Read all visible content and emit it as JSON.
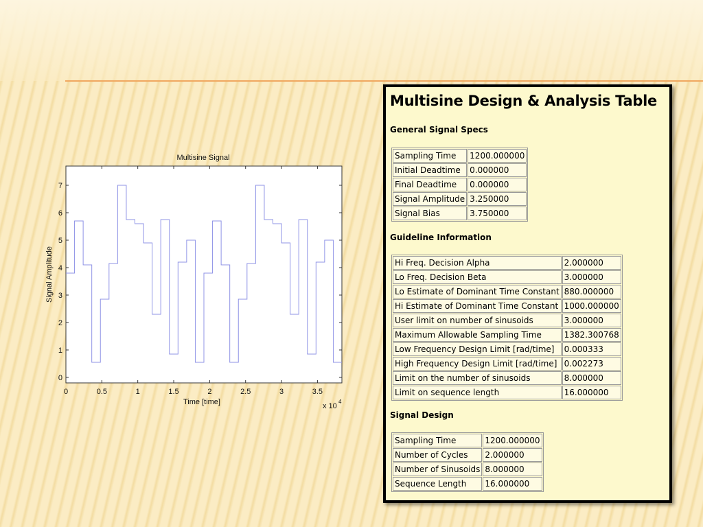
{
  "chart_data": {
    "type": "line",
    "title": "Multisine Signal",
    "xlabel": "Time [time]",
    "ylabel": "Signal Amplitude",
    "x_multiplier_label": "x 10",
    "x_multiplier_exp": "4",
    "xlim": [
      0,
      3.84
    ],
    "ylim": [
      -0.2,
      7.7
    ],
    "x_ticks": [
      "0",
      "0.5",
      "1",
      "1.5",
      "2",
      "2.5",
      "3",
      "3.5"
    ],
    "y_ticks": [
      "0",
      "1",
      "2",
      "3",
      "4",
      "5",
      "6",
      "7"
    ],
    "grid": false,
    "series": [
      {
        "color": "#8f93e6",
        "step": "post",
        "x": [
          0,
          0.12,
          0.24,
          0.36,
          0.48,
          0.6,
          0.72,
          0.84,
          0.96,
          1.08,
          1.2,
          1.32,
          1.44,
          1.56,
          1.68,
          1.8,
          1.92,
          2.04,
          2.16,
          2.28,
          2.4,
          2.52,
          2.64,
          2.76,
          2.88,
          3.0,
          3.12,
          3.24,
          3.36,
          3.48,
          3.6,
          3.72,
          3.84
        ],
        "values": [
          3.8,
          5.7,
          4.1,
          0.55,
          2.85,
          4.15,
          7.0,
          5.75,
          5.6,
          4.9,
          2.3,
          5.75,
          0.85,
          4.2,
          5.0,
          0.55,
          3.8,
          5.7,
          4.1,
          0.55,
          2.85,
          4.15,
          7.0,
          5.75,
          5.6,
          4.9,
          2.3,
          5.75,
          0.85,
          4.2,
          5.0,
          0.55,
          0.55
        ]
      }
    ]
  },
  "panel": {
    "title": "Multisine Design & Analysis Table",
    "sections": {
      "general": {
        "heading": "General Signal Specs",
        "rows": [
          [
            "Sampling Time",
            "1200.000000"
          ],
          [
            "Initial Deadtime",
            "0.000000"
          ],
          [
            "Final Deadtime",
            "0.000000"
          ],
          [
            "Signal Amplitude",
            "3.250000"
          ],
          [
            "Signal Bias",
            "3.750000"
          ]
        ]
      },
      "guideline": {
        "heading": "Guideline Information",
        "rows": [
          [
            "Hi Freq. Decision Alpha",
            "2.000000"
          ],
          [
            "Lo Freq. Decision Beta",
            "3.000000"
          ],
          [
            "Lo Estimate of Dominant Time Constant",
            "880.000000"
          ],
          [
            "Hi Estimate of Dominant Time Constant",
            "1000.000000"
          ],
          [
            "User limit on number of sinusoids",
            "3.000000"
          ],
          [
            "Maximum Allowable Sampling Time",
            "1382.300768"
          ],
          [
            "Low Frequency Design Limit [rad/time]",
            "0.000333"
          ],
          [
            "High Frequency Design Limit [rad/time]",
            "0.002273"
          ],
          [
            "Limit on the number of sinusoids",
            "8.000000"
          ],
          [
            "Limit on sequence length",
            "16.000000"
          ]
        ]
      },
      "design": {
        "heading": "Signal Design",
        "rows": [
          [
            "Sampling Time",
            "1200.000000"
          ],
          [
            "Number of Cycles",
            "2.000000"
          ],
          [
            "Number of Sinusoids",
            "8.000000"
          ],
          [
            "Sequence Length",
            "16.000000"
          ]
        ]
      }
    }
  }
}
